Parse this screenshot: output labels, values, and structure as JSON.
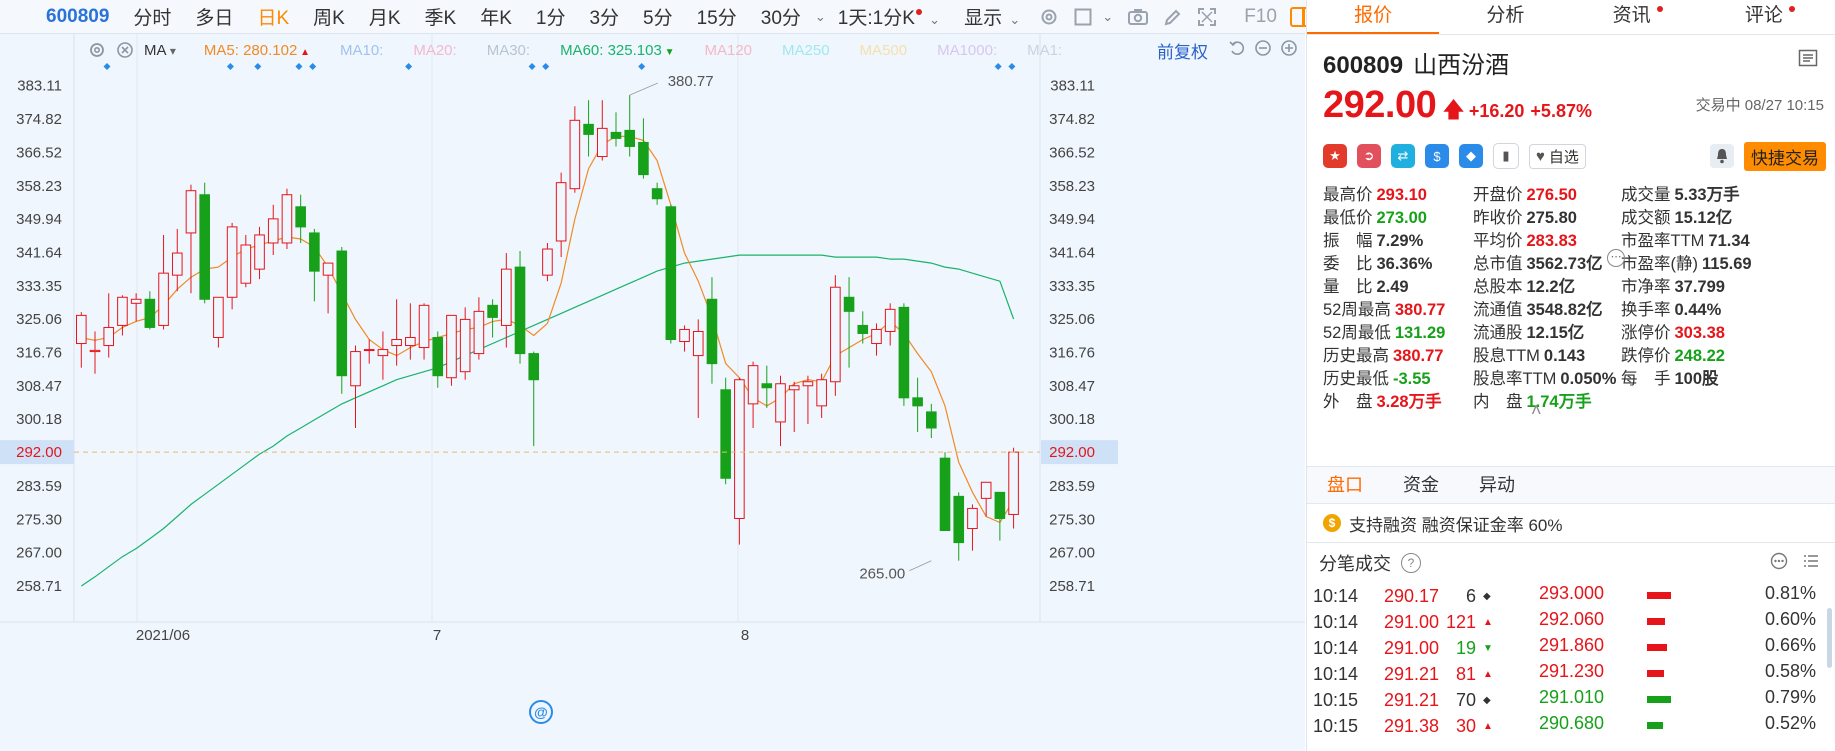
{
  "toolbar": {
    "code": "600809",
    "periods": [
      {
        "label": "分时",
        "active": false
      },
      {
        "label": "多日",
        "active": false
      },
      {
        "label": "日K",
        "active": true
      },
      {
        "label": "周K",
        "active": false
      },
      {
        "label": "月K",
        "active": false
      },
      {
        "label": "季K",
        "active": false
      },
      {
        "label": "年K",
        "active": false
      },
      {
        "label": "1分",
        "active": false
      },
      {
        "label": "3分",
        "active": false
      },
      {
        "label": "5分",
        "active": false
      },
      {
        "label": "15分",
        "active": false
      },
      {
        "label": "30分",
        "active": false
      }
    ],
    "custom_period": "1天:1分K",
    "display_label": "显示",
    "f10_label": "F10",
    "tools": [
      "settings-icon",
      "square-icon",
      "camera-icon",
      "pen-icon",
      "expand-icon"
    ]
  },
  "indicator_bar": {
    "ma_label": "MA",
    "items": [
      {
        "text": "MA5: 280.102",
        "color": "#f08a24",
        "dim": false,
        "arrow": "up"
      },
      {
        "text": "MA10:",
        "color": "#9ec4ef",
        "dim": true
      },
      {
        "text": "MA20:",
        "color": "#f3b8d0",
        "dim": true
      },
      {
        "text": "MA30:",
        "color": "#b8c4d2",
        "dim": true
      },
      {
        "text": "MA60: 325.103",
        "color": "#19b36b",
        "dim": false,
        "arrow": "down"
      },
      {
        "text": "MA120",
        "color": "#f3b8c8",
        "dim": true
      },
      {
        "text": "MA250",
        "color": "#9fe8f0",
        "dim": true
      },
      {
        "text": "MA500",
        "color": "#f5dfae",
        "dim": true
      },
      {
        "text": "MA1000:",
        "color": "#d6c6f0",
        "dim": true
      },
      {
        "text": "MA1:",
        "color": "#c9d3e0",
        "dim": true
      }
    ],
    "adjust_label": "前复权"
  },
  "chart_data": {
    "type": "candlestick",
    "y_ticks": [
      "383.11",
      "374.82",
      "366.52",
      "358.23",
      "349.94",
      "341.64",
      "333.35",
      "325.06",
      "316.76",
      "308.47",
      "300.18",
      "292.00",
      "283.59",
      "275.30",
      "267.00",
      "258.71"
    ],
    "ylim": [
      254.56,
      387.25
    ],
    "x_labels": [
      {
        "label": "2021/06",
        "index": 5
      },
      {
        "label": "7",
        "index": 26
      },
      {
        "label": "8",
        "index": 48
      }
    ],
    "current_price": 292.0,
    "current_price_label": "292.00",
    "high_marker": {
      "value": 380.77,
      "label": "380.77",
      "index": 40
    },
    "low_marker": {
      "value": 265.0,
      "label": "265.00",
      "index": 62
    },
    "event_marker_indices": [
      1,
      10,
      12,
      15,
      16,
      23,
      32,
      33,
      40,
      66,
      67
    ],
    "candles": [
      {
        "o": 319.0,
        "h": 326.8,
        "l": 313.0,
        "c": 326.0
      },
      {
        "o": 317.0,
        "h": 322.0,
        "l": 311.5,
        "c": 317.3
      },
      {
        "o": 318.5,
        "h": 331.5,
        "l": 315.5,
        "c": 323.0
      },
      {
        "o": 323.5,
        "h": 331.0,
        "l": 321.0,
        "c": 330.5
      },
      {
        "o": 329.0,
        "h": 331.5,
        "l": 324.5,
        "c": 330.0
      },
      {
        "o": 330.0,
        "h": 332.0,
        "l": 322.5,
        "c": 323.0
      },
      {
        "o": 323.5,
        "h": 346.0,
        "l": 322.5,
        "c": 336.5
      },
      {
        "o": 336.0,
        "h": 347.5,
        "l": 332.0,
        "c": 341.5
      },
      {
        "o": 346.5,
        "h": 358.5,
        "l": 331.5,
        "c": 357.0
      },
      {
        "o": 356.0,
        "h": 359.0,
        "l": 329.0,
        "c": 330.0
      },
      {
        "o": 320.5,
        "h": 330.5,
        "l": 318.0,
        "c": 330.5
      },
      {
        "o": 330.5,
        "h": 349.0,
        "l": 327.5,
        "c": 348.0
      },
      {
        "o": 334.0,
        "h": 346.0,
        "l": 333.0,
        "c": 343.5
      },
      {
        "o": 337.5,
        "h": 348.0,
        "l": 335.0,
        "c": 346.0
      },
      {
        "o": 344.0,
        "h": 353.5,
        "l": 341.0,
        "c": 350.0
      },
      {
        "o": 344.0,
        "h": 357.5,
        "l": 342.5,
        "c": 356.0
      },
      {
        "o": 353.0,
        "h": 356.0,
        "l": 344.0,
        "c": 348.0
      },
      {
        "o": 346.5,
        "h": 347.5,
        "l": 329.5,
        "c": 337.0
      },
      {
        "o": 336.0,
        "h": 339.0,
        "l": 326.5,
        "c": 339.0
      },
      {
        "o": 342.0,
        "h": 343.0,
        "l": 306.5,
        "c": 311.0
      },
      {
        "o": 308.5,
        "h": 318.5,
        "l": 298.0,
        "c": 317.0
      },
      {
        "o": 317.5,
        "h": 320.0,
        "l": 314.0,
        "c": 317.5
      },
      {
        "o": 316.0,
        "h": 322.0,
        "l": 310.0,
        "c": 317.5
      },
      {
        "o": 318.5,
        "h": 330.0,
        "l": 313.5,
        "c": 320.0
      },
      {
        "o": 318.5,
        "h": 329.0,
        "l": 315.0,
        "c": 320.5
      },
      {
        "o": 318.0,
        "h": 329.0,
        "l": 315.0,
        "c": 328.5
      },
      {
        "o": 320.5,
        "h": 322.0,
        "l": 308.0,
        "c": 311.0
      },
      {
        "o": 310.5,
        "h": 325.0,
        "l": 308.5,
        "c": 326.0
      },
      {
        "o": 312.0,
        "h": 328.0,
        "l": 310.0,
        "c": 325.0
      },
      {
        "o": 316.5,
        "h": 330.5,
        "l": 315.0,
        "c": 327.0
      },
      {
        "o": 328.5,
        "h": 330.0,
        "l": 320.5,
        "c": 325.5
      },
      {
        "o": 323.5,
        "h": 341.5,
        "l": 318.0,
        "c": 337.5
      },
      {
        "o": 338.0,
        "h": 342.0,
        "l": 314.0,
        "c": 316.5
      },
      {
        "o": 316.5,
        "h": 317.0,
        "l": 293.5,
        "c": 310.0
      },
      {
        "o": 336.0,
        "h": 344.0,
        "l": 334.5,
        "c": 342.5
      },
      {
        "o": 344.5,
        "h": 361.5,
        "l": 340.5,
        "c": 359.0
      },
      {
        "o": 357.5,
        "h": 378.0,
        "l": 356.5,
        "c": 374.5
      },
      {
        "o": 373.5,
        "h": 379.5,
        "l": 365.5,
        "c": 371.0
      },
      {
        "o": 365.5,
        "h": 379.5,
        "l": 364.5,
        "c": 372.5
      },
      {
        "o": 371.5,
        "h": 376.5,
        "l": 368.0,
        "c": 370.0
      },
      {
        "o": 372.0,
        "h": 380.77,
        "l": 365.5,
        "c": 368.0
      },
      {
        "o": 369.0,
        "h": 375.0,
        "l": 360.0,
        "c": 361.0
      },
      {
        "o": 357.5,
        "h": 359.0,
        "l": 353.5,
        "c": 355.0
      },
      {
        "o": 353.0,
        "h": 353.5,
        "l": 319.0,
        "c": 320.0
      },
      {
        "o": 319.5,
        "h": 323.5,
        "l": 317.0,
        "c": 322.5
      },
      {
        "o": 316.0,
        "h": 325.0,
        "l": 300.5,
        "c": 322.0
      },
      {
        "o": 330.0,
        "h": 335.5,
        "l": 309.0,
        "c": 314.0
      },
      {
        "o": 307.5,
        "h": 310.5,
        "l": 284.0,
        "c": 285.5
      },
      {
        "o": 275.5,
        "h": 310.5,
        "l": 269.0,
        "c": 310.0
      },
      {
        "o": 304.0,
        "h": 314.5,
        "l": 298.0,
        "c": 313.5
      },
      {
        "o": 309.0,
        "h": 313.5,
        "l": 303.0,
        "c": 308.0
      },
      {
        "o": 299.5,
        "h": 311.0,
        "l": 293.5,
        "c": 309.0
      },
      {
        "o": 307.5,
        "h": 309.5,
        "l": 297.0,
        "c": 308.5
      },
      {
        "o": 308.5,
        "h": 311.0,
        "l": 299.0,
        "c": 309.5
      },
      {
        "o": 303.5,
        "h": 311.5,
        "l": 300.5,
        "c": 310.0
      },
      {
        "o": 309.5,
        "h": 336.0,
        "l": 306.0,
        "c": 333.0
      },
      {
        "o": 330.5,
        "h": 335.5,
        "l": 313.0,
        "c": 327.0
      },
      {
        "o": 323.5,
        "h": 327.0,
        "l": 319.0,
        "c": 321.5
      },
      {
        "o": 319.0,
        "h": 324.0,
        "l": 316.0,
        "c": 322.5
      },
      {
        "o": 322.0,
        "h": 329.0,
        "l": 318.5,
        "c": 327.5
      },
      {
        "o": 328.0,
        "h": 329.0,
        "l": 303.5,
        "c": 305.5
      },
      {
        "o": 305.5,
        "h": 310.5,
        "l": 297.0,
        "c": 303.5
      },
      {
        "o": 302.0,
        "h": 304.0,
        "l": 295.5,
        "c": 298.0
      },
      {
        "o": 290.5,
        "h": 292.0,
        "l": 272.5,
        "c": 272.5
      },
      {
        "o": 281.0,
        "h": 282.0,
        "l": 265.0,
        "c": 269.5
      },
      {
        "o": 273.0,
        "h": 279.0,
        "l": 267.5,
        "c": 278.0
      },
      {
        "o": 280.5,
        "h": 283.5,
        "l": 276.0,
        "c": 284.5
      },
      {
        "o": 282.0,
        "h": 282.0,
        "l": 270.0,
        "c": 275.5
      },
      {
        "o": 276.5,
        "h": 293.1,
        "l": 273.0,
        "c": 292.0
      }
    ],
    "ma5": [
      320.4,
      319.8,
      320.5,
      323.0,
      324.5,
      325.5,
      328.5,
      332.5,
      335.5,
      337.5,
      338.0,
      340.5,
      342.5,
      343.5,
      344.5,
      345.5,
      345.0,
      343.0,
      338.0,
      331.5,
      325.0,
      320.0,
      317.5,
      316.0,
      318.0,
      319.5,
      320.5,
      321.5,
      322.5,
      323.0,
      324.5,
      325.0,
      323.5,
      321.0,
      324.0,
      334.0,
      350.0,
      362.5,
      368.5,
      370.5,
      370.5,
      369.5,
      364.5,
      353.5,
      341.5,
      334.5,
      325.5,
      314.0,
      310.5,
      305.5,
      303.5,
      305.5,
      309.0,
      310.0,
      309.5,
      316.0,
      318.0,
      320.0,
      321.5,
      324.5,
      321.5,
      316.5,
      312.0,
      303.5,
      289.5,
      282.0,
      276.0,
      274.5,
      280.1
    ],
    "ma60": [
      258.71,
      261.0,
      263.5,
      266.0,
      268.0,
      270.5,
      273.0,
      276.0,
      279.0,
      281.5,
      284.0,
      286.5,
      289.0,
      291.5,
      293.5,
      296.0,
      298.0,
      300.0,
      302.0,
      304.0,
      305.5,
      307.0,
      308.5,
      310.0,
      311.0,
      312.0,
      313.0,
      314.5,
      316.0,
      317.5,
      319.0,
      320.5,
      322.0,
      323.5,
      325.0,
      326.5,
      328.0,
      329.5,
      331.0,
      332.5,
      334.0,
      335.5,
      337.0,
      338.0,
      339.0,
      339.5,
      340.0,
      340.5,
      341.0,
      341.0,
      341.0,
      341.0,
      341.0,
      341.0,
      341.0,
      340.5,
      340.5,
      340.5,
      340.5,
      340.0,
      340.0,
      339.5,
      339.0,
      338.0,
      337.5,
      336.5,
      335.5,
      334.5,
      325.1
    ]
  },
  "quote": {
    "tabs": [
      {
        "label": "报价",
        "active": true,
        "dot": false
      },
      {
        "label": "分析",
        "active": false,
        "dot": false
      },
      {
        "label": "资讯",
        "active": false,
        "dot": true
      },
      {
        "label": "评论",
        "active": false,
        "dot": true
      }
    ],
    "code": "600809",
    "name": "山西汾酒",
    "price": "292.00",
    "change": "+16.20",
    "change_pct": "+5.87%",
    "status": "交易中 08/27 10:15",
    "zixuan_label": "自选",
    "quick_trade_label": "快捷交易",
    "fields": [
      {
        "label": "最高价",
        "value": "293.10",
        "color": "red",
        "col": 0,
        "row": 0
      },
      {
        "label": "开盘价",
        "value": "276.50",
        "color": "red",
        "col": 1,
        "row": 0
      },
      {
        "label": "成交量",
        "value": "5.33万手",
        "color": "dark",
        "col": 2,
        "row": 0
      },
      {
        "label": "最低价",
        "value": "273.00",
        "color": "green",
        "col": 0,
        "row": 1
      },
      {
        "label": "昨收价",
        "value": "275.80",
        "color": "dark",
        "col": 1,
        "row": 1
      },
      {
        "label": "成交额",
        "value": "15.12亿",
        "color": "dark",
        "col": 2,
        "row": 1
      },
      {
        "label": "振　幅",
        "value": "7.29%",
        "color": "dark",
        "col": 0,
        "row": 2
      },
      {
        "label": "平均价",
        "value": "283.83",
        "color": "red",
        "col": 1,
        "row": 2
      },
      {
        "label": "市盈率TTM",
        "value": "71.34",
        "color": "dark",
        "col": 2,
        "row": 2
      },
      {
        "label": "委　比",
        "value": "36.36%",
        "color": "dark",
        "col": 0,
        "row": 3
      },
      {
        "label": "总市值",
        "value": "3562.73亿",
        "color": "dark",
        "col": 1,
        "row": 3
      },
      {
        "label": "市盈率(静)",
        "value": "115.69",
        "color": "dark",
        "col": 2,
        "row": 3
      },
      {
        "label": "量　比",
        "value": "2.49",
        "color": "dark",
        "col": 0,
        "row": 4
      },
      {
        "label": "总股本",
        "value": "12.2亿",
        "color": "dark",
        "col": 1,
        "row": 4
      },
      {
        "label": "市净率",
        "value": "37.799",
        "color": "dark",
        "col": 2,
        "row": 4
      },
      {
        "label": "52周最高",
        "value": "380.77",
        "color": "red",
        "col": 0,
        "row": 5
      },
      {
        "label": "流通值",
        "value": "3548.82亿",
        "color": "dark",
        "col": 1,
        "row": 5
      },
      {
        "label": "换手率",
        "value": "0.44%",
        "color": "dark",
        "col": 2,
        "row": 5
      },
      {
        "label": "52周最低",
        "value": "131.29",
        "color": "green",
        "col": 0,
        "row": 6
      },
      {
        "label": "流通股",
        "value": "12.15亿",
        "color": "dark",
        "col": 1,
        "row": 6
      },
      {
        "label": "涨停价",
        "value": "303.38",
        "color": "red",
        "col": 2,
        "row": 6
      },
      {
        "label": "历史最高",
        "value": "380.77",
        "color": "red",
        "col": 0,
        "row": 7
      },
      {
        "label": "股息TTM",
        "value": "0.143",
        "color": "dark",
        "col": 1,
        "row": 7
      },
      {
        "label": "跌停价",
        "value": "248.22",
        "color": "green",
        "col": 2,
        "row": 7
      },
      {
        "label": "历史最低",
        "value": "-3.55",
        "color": "green",
        "col": 0,
        "row": 8
      },
      {
        "label": "股息率TTM",
        "value": "0.050%",
        "color": "dark",
        "col": 1,
        "row": 8
      },
      {
        "label": "每　手",
        "value": "100股",
        "color": "dark",
        "col": 2,
        "row": 8
      },
      {
        "label": "外　盘",
        "value": "3.28万手",
        "color": "red",
        "col": 0,
        "row": 9
      },
      {
        "label": "内　盘",
        "value": "1.74万手",
        "color": "green",
        "col": 1,
        "row": 9
      }
    ],
    "section_tabs": [
      {
        "label": "盘口",
        "active": true
      },
      {
        "label": "资金",
        "active": false
      },
      {
        "label": "异动",
        "active": false
      }
    ],
    "margin_note": "支持融资  融资保证金率 60%",
    "ticks_title": "分笔成交",
    "ticks": [
      {
        "time": "10:14",
        "price": "290.17",
        "vol": "6",
        "dir": "flat",
        "price_color": "red",
        "vol_color": "dark"
      },
      {
        "time": "10:14",
        "price": "291.00",
        "vol": "121",
        "dir": "up",
        "price_color": "red",
        "vol_color": "red"
      },
      {
        "time": "10:14",
        "price": "291.00",
        "vol": "19",
        "dir": "down",
        "price_color": "red",
        "vol_color": "green"
      },
      {
        "time": "10:14",
        "price": "291.21",
        "vol": "81",
        "dir": "up",
        "price_color": "red",
        "vol_color": "red"
      },
      {
        "time": "10:15",
        "price": "291.21",
        "vol": "70",
        "dir": "flat",
        "price_color": "red",
        "vol_color": "dark"
      },
      {
        "time": "10:15",
        "price": "291.38",
        "vol": "30",
        "dir": "up",
        "price_color": "red",
        "vol_color": "red"
      }
    ],
    "levels": [
      {
        "price": "293.000",
        "pct": "0.81%",
        "color": "red",
        "bar": 0.81
      },
      {
        "price": "292.060",
        "pct": "0.60%",
        "color": "red",
        "bar": 0.6
      },
      {
        "price": "291.860",
        "pct": "0.66%",
        "color": "red",
        "bar": 0.66
      },
      {
        "price": "291.230",
        "pct": "0.58%",
        "color": "red",
        "bar": 0.58
      },
      {
        "price": "291.010",
        "pct": "0.79%",
        "color": "green",
        "bar": 0.79
      },
      {
        "price": "290.680",
        "pct": "0.52%",
        "color": "green",
        "bar": 0.52
      }
    ]
  },
  "colors": {
    "up": "#e5151a",
    "down": "#17a11a",
    "accent": "#ff6a00",
    "ma5": "#f08a24",
    "ma60": "#19b36b",
    "marker": "#2a8be8"
  }
}
